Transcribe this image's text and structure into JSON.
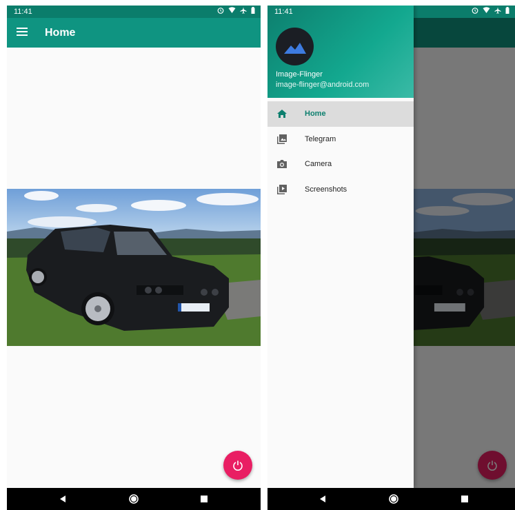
{
  "status_bar": {
    "time": "11:41"
  },
  "app_bar": {
    "title": "Home"
  },
  "drawer": {
    "user_name": "Image-Flinger",
    "user_email": "image-flinger@android.com",
    "items": [
      {
        "label": "Home",
        "icon": "home-icon",
        "active": true
      },
      {
        "label": "Telegram",
        "icon": "photo-library-icon",
        "active": false
      },
      {
        "label": "Camera",
        "icon": "camera-icon",
        "active": false
      },
      {
        "label": "Screenshots",
        "icon": "video-library-icon",
        "active": false
      }
    ]
  },
  "colors": {
    "primary": "#0f9481",
    "primary_dark": "#0b7d6b",
    "accent": "#e91e63",
    "active_item_bg": "#dcdcdc"
  }
}
